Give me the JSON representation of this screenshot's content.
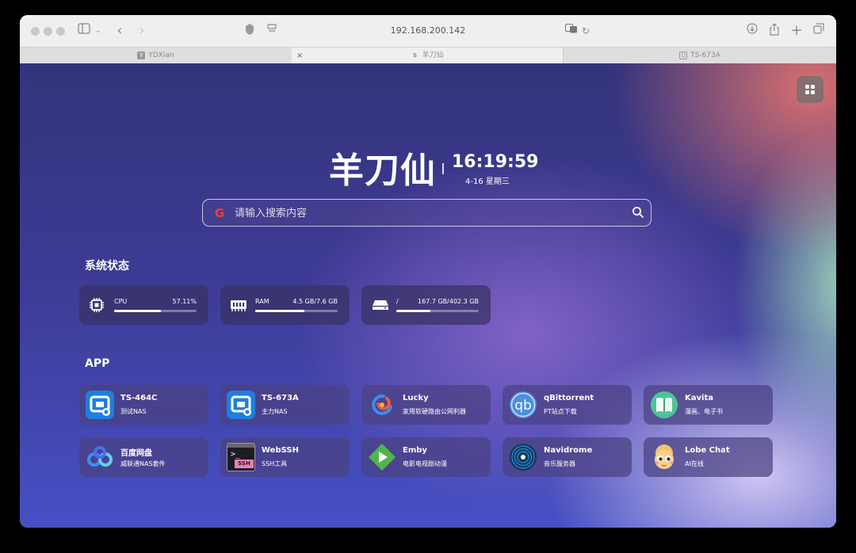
{
  "browser": {
    "address": "192.168.200.142",
    "tabs": [
      {
        "label": "YDXian",
        "icon_text": "Y"
      },
      {
        "label": "羊刀仙",
        "icon_text": "S"
      },
      {
        "label": "TS-673A",
        "icon_text": "Q"
      }
    ],
    "tab_close": "×"
  },
  "header": {
    "brand": "羊刀仙",
    "time": "16:19:59",
    "date": "4-16 星期三"
  },
  "search": {
    "placeholder": "请输入搜索内容"
  },
  "system": {
    "title": "系统状态",
    "stats": [
      {
        "label": "CPU",
        "value": "57.11%",
        "fraction": 0.5711,
        "icon": "cpu-icon"
      },
      {
        "label": "RAM",
        "value": "4.5 GB/7.6 GB",
        "fraction": 0.592,
        "icon": "ram-icon"
      },
      {
        "label": "/",
        "value": "167.7 GB/402.3 GB",
        "fraction": 0.417,
        "icon": "disk-icon"
      }
    ]
  },
  "apps": {
    "title": "APP",
    "items": [
      {
        "name": "TS-464C",
        "desc": "测试NAS",
        "icon": "qnap-icon"
      },
      {
        "name": "TS-673A",
        "desc": "主力NAS",
        "icon": "qnap-icon"
      },
      {
        "name": "Lucky",
        "desc": "家用软硬路由公网利器",
        "icon": "lucky-icon"
      },
      {
        "name": "qBittorrent",
        "desc": "PT站点下载",
        "icon": "qbittorrent-icon"
      },
      {
        "name": "Kavita",
        "desc": "漫画、电子书",
        "icon": "kavita-icon"
      },
      {
        "name": "百度网盘",
        "desc": "威联通NAS套件",
        "icon": "baidu-netdisk-icon"
      },
      {
        "name": "WebSSH",
        "desc": "SSH工具",
        "icon": "webssh-icon",
        "icon_text": "SSH"
      },
      {
        "name": "Emby",
        "desc": "电影电视剧动漫",
        "icon": "emby-icon"
      },
      {
        "name": "Navidrome",
        "desc": "音乐服务器",
        "icon": "navidrome-icon"
      },
      {
        "name": "Lobe Chat",
        "desc": "AI在线",
        "icon": "lobe-chat-icon"
      }
    ]
  },
  "colors": {
    "background_top": "#34347c",
    "background_bottom": "#4650c4",
    "accent_coral": "#e2736e",
    "accent_mint": "#aae6be"
  }
}
